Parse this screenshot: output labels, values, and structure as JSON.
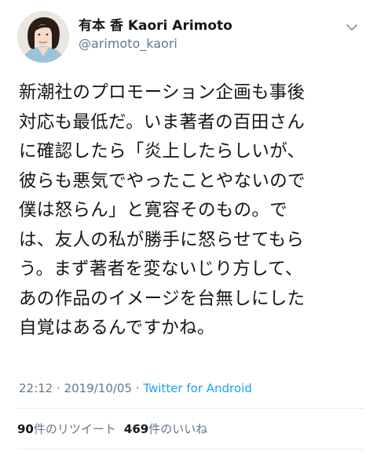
{
  "header": {
    "display_name": "有本 香 Kaori Arimoto",
    "handle": "@arimoto_kaori",
    "menu_icon": "chevron-down-icon",
    "avatar_icon": "profile-photo"
  },
  "tweet": {
    "lines": [
      "新潮社のプロモーション企画も事後",
      "対応も最低だ。いま著者の百田さん",
      "に確認したら「炎上したらしいが、",
      "彼らも悪気でやったことやないので",
      "僕は怒らん」と寛容そのもの。で",
      "は、友人の私が勝手に怒らせてもら",
      "う。まず著者を変ないじり方して、",
      "あの作品のイメージを台無しにした",
      "自覚はあるんですかね。"
    ]
  },
  "meta": {
    "time": "22:12",
    "sep1": " · ",
    "date": "2019/10/05",
    "sep2": " · ",
    "source": "Twitter for Android"
  },
  "stats": {
    "retweets_count": "90",
    "retweets_label": "件のリツイート",
    "likes_count": "469",
    "likes_label": "件のいいね"
  },
  "colors": {
    "text": "#14171a",
    "secondary": "#657786",
    "link": "#1da1f2",
    "divider": "#e6ecf0"
  }
}
